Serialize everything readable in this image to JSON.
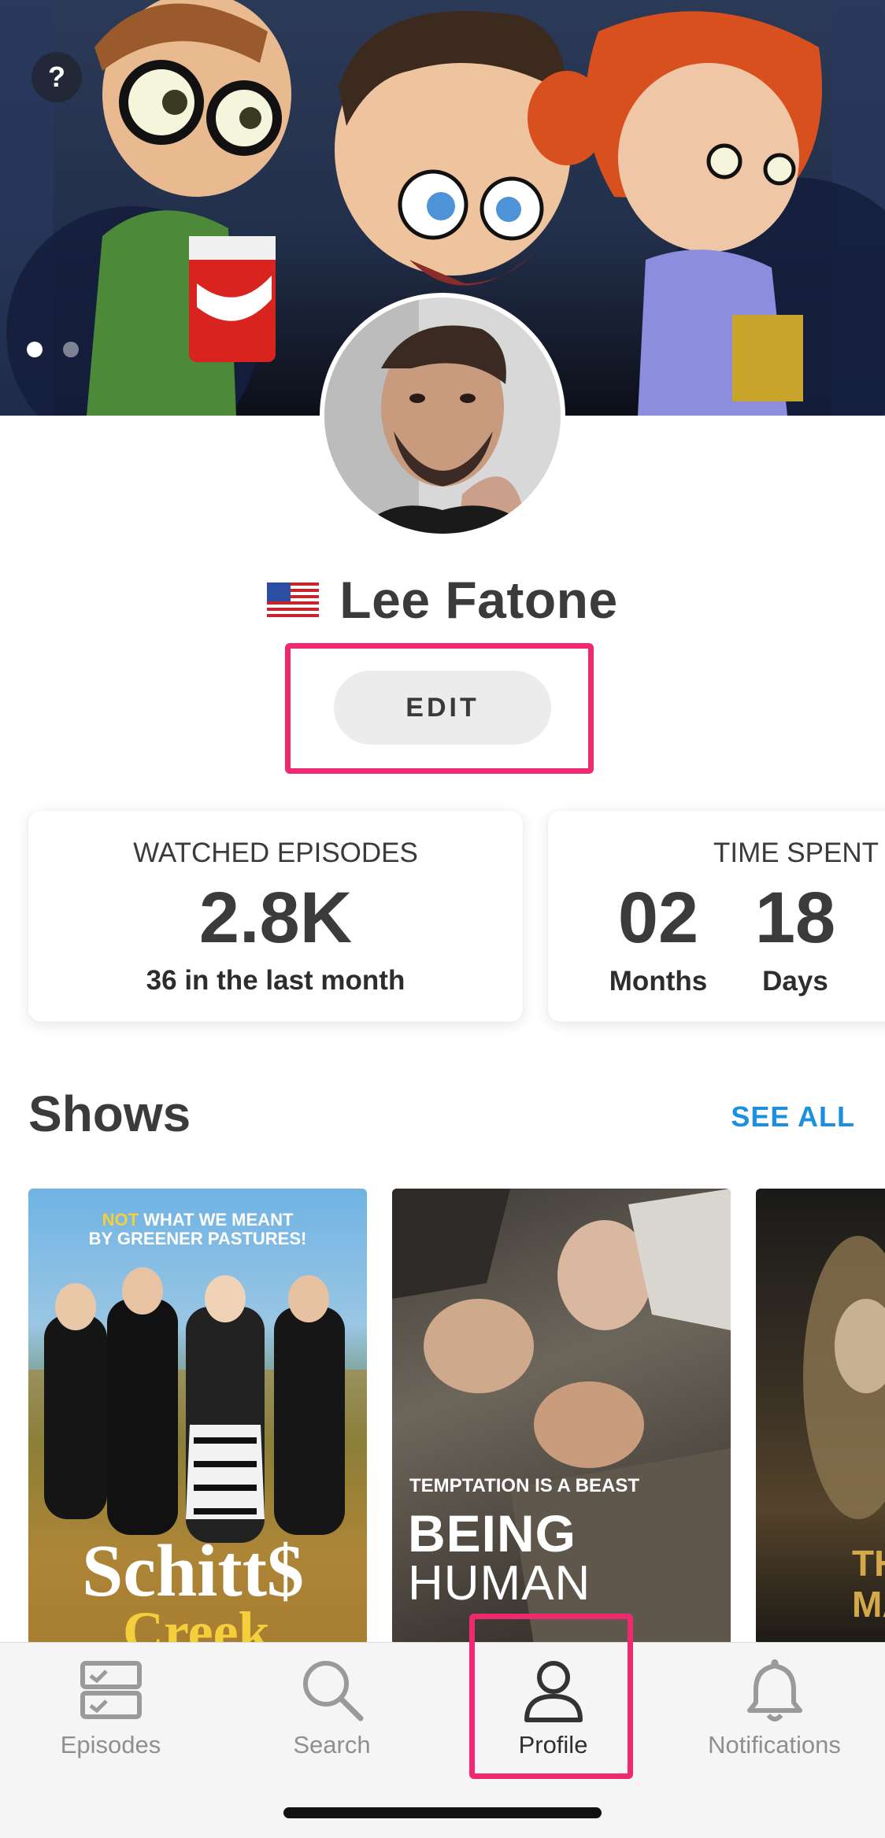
{
  "header": {
    "help_label": "?",
    "carousel": {
      "count": 2,
      "active_index": 0
    }
  },
  "profile": {
    "name": "Lee Fatone",
    "flag_icon": "us-flag-icon",
    "edit_label": "EDIT",
    "highlight_color": "#f0286f"
  },
  "stats": {
    "watched": {
      "label": "WATCHED EPISODES",
      "value": "2.8K",
      "sub": "36 in the last month"
    },
    "time_spent": {
      "label": "TIME SPENT",
      "months_value": "02",
      "months_unit": "Months",
      "days_value": "18",
      "days_unit": "Days"
    }
  },
  "shows": {
    "title": "Shows",
    "see_all_label": "SEE ALL",
    "accent_color": "#1b8fe0",
    "posters": [
      {
        "tag_highlight": "NOT",
        "tag_rest": "WHAT WE MEANT",
        "tag_line2": "BY GREENER PASTURES!",
        "title_line1": "Schitt$",
        "title_line2": "Creek"
      },
      {
        "tag": "TEMPTATION IS A BEAST",
        "title_line1": "BEING",
        "title_line2": "HUMAN"
      },
      {
        "title_line1": "THE",
        "title_line2": "MA"
      }
    ]
  },
  "tabs": [
    {
      "label": "Episodes",
      "icon": "episodes-checklist-icon"
    },
    {
      "label": "Search",
      "icon": "search-icon"
    },
    {
      "label": "Profile",
      "icon": "profile-person-icon",
      "active": true
    },
    {
      "label": "Notifications",
      "icon": "bell-icon"
    }
  ]
}
